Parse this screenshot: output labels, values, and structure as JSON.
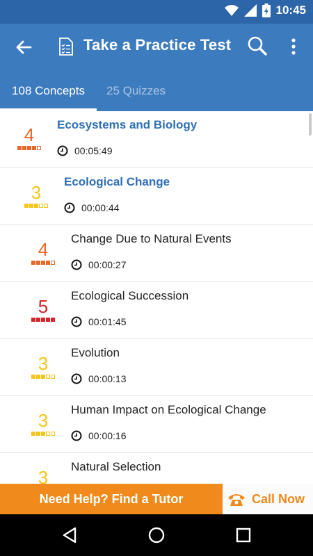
{
  "status_bar": {
    "time": "10:45"
  },
  "app_bar": {
    "title": "Take a Practice Test"
  },
  "tabs": [
    {
      "label": "108 Concepts",
      "active": true
    },
    {
      "label": "25 Quizzes",
      "active": false
    }
  ],
  "items": [
    {
      "level": "4",
      "level_value": 4,
      "color": "#e8682a",
      "name": "Ecosystems and Biology",
      "duration": "00:05:49",
      "chapter": true
    },
    {
      "level": "3",
      "level_value": 3,
      "color": "#f5c518",
      "name": "Ecological Change",
      "duration": "00:00:44",
      "chapter": true
    },
    {
      "level": "4",
      "level_value": 4,
      "color": "#e8682a",
      "name": "Change Due to Natural Events",
      "duration": "00:00:27",
      "chapter": false
    },
    {
      "level": "5",
      "level_value": 5,
      "color": "#d3262b",
      "name": "Ecological Succession",
      "duration": "00:01:45",
      "chapter": false
    },
    {
      "level": "3",
      "level_value": 3,
      "color": "#f5c518",
      "name": "Evolution",
      "duration": "00:00:13",
      "chapter": false
    },
    {
      "level": "3",
      "level_value": 3,
      "color": "#f5c518",
      "name": "Human Impact on Ecological Change",
      "duration": "00:00:16",
      "chapter": false
    },
    {
      "level": "3",
      "level_value": 3,
      "color": "#f5c518",
      "name": "Natural Selection",
      "duration": "",
      "chapter": false
    }
  ],
  "help_bar": {
    "tutor_label": "Need Help? Find a Tutor",
    "call_label": "Call Now",
    "accent": "#f08a1c"
  },
  "colors": {
    "primary": "#3d7bbf",
    "status": "#2c65a8",
    "link": "#2f6fb5"
  }
}
